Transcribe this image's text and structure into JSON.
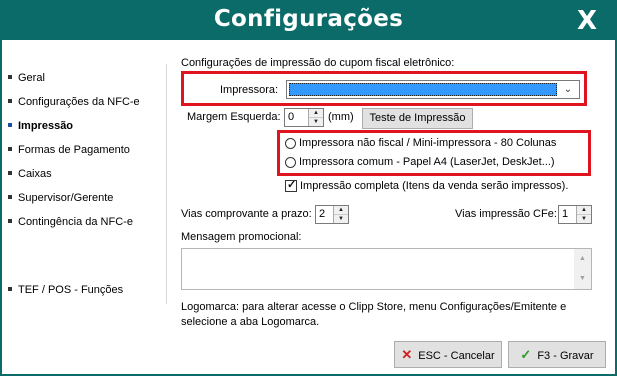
{
  "window": {
    "title": "Configurações",
    "close_label": "X"
  },
  "sidebar": {
    "items": [
      {
        "label": "Geral"
      },
      {
        "label": "Configurações da NFC-e"
      },
      {
        "label": "Impressão"
      },
      {
        "label": "Formas de Pagamento"
      },
      {
        "label": "Caixas"
      },
      {
        "label": "Supervisor/Gerente"
      },
      {
        "label": "Contingência da NFC-e"
      },
      {
        "label": "TEF / POS - Funções"
      }
    ],
    "active_item": "Impressão"
  },
  "main": {
    "section_title": "Configurações de impressão do cupom fiscal eletrônico:",
    "printer_label": "Impressora:",
    "printer_value": "",
    "margin_label": "Margem Esquerda:",
    "margin_value": "0",
    "margin_unit": "(mm)",
    "test_button": "Teste de Impressão",
    "radio_options": [
      {
        "label": "Impressora não fiscal / Mini-impressora - 80 Colunas",
        "selected": false
      },
      {
        "label": "Impressora comum - Papel A4 (LaserJet, DeskJet...)",
        "selected": false
      }
    ],
    "full_print_label": "Impressão completa (Itens da venda serão impressos).",
    "full_print_checked": true,
    "vias_prazo_label": "Vias comprovante a prazo:",
    "vias_prazo_value": "2",
    "vias_cfe_label": "Vias impressão CFe:",
    "vias_cfe_value": "1",
    "promo_label": "Mensagem promocional:",
    "promo_value": "",
    "logo_note_line1": "Logomarca: para alterar acesse o Clipp Store, menu Configurações/Emitente e",
    "logo_note_line2": "selecione a aba Logomarca."
  },
  "footer": {
    "cancel_label": "ESC - Cancelar",
    "save_label": "F3 - Gravar"
  },
  "colors": {
    "titlebar": "#0a6b68",
    "highlight_box": "#e0141e",
    "select_fill": "#3399ff",
    "cancel_icon": "#d01f1f",
    "save_icon": "#2e9a2e"
  }
}
